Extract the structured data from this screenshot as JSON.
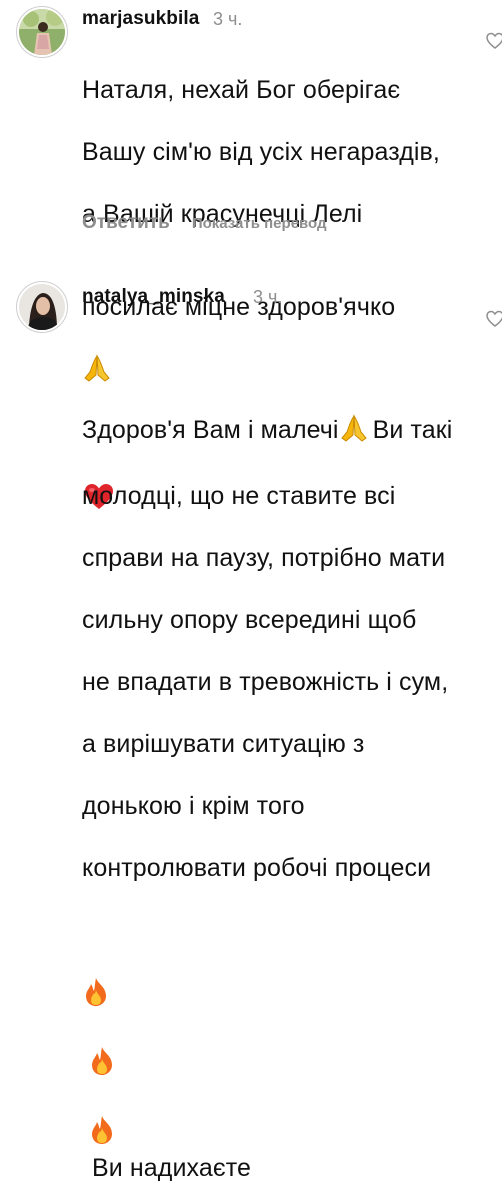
{
  "comments": [
    {
      "username": "marjasukbila",
      "time": "3 ч.",
      "text_lines": [
        "Наталя, нехай Бог оберігає",
        "Вашу сім'ю від усіх негараздів,",
        "а Вашій красунечці Лелі",
        "посилає міцне здоров'ячко"
      ],
      "reply_label": "Ответить",
      "translate_label": "Показать перевод",
      "emoji": [
        "praying-hands",
        "red-heart"
      ]
    },
    {
      "username": "natalya_minska",
      "time": "3 ч.",
      "text_lines": [
        "Здоров'я Вам і малечі",
        "Ви такі",
        "молодці, що не ставите всі",
        "справи на паузу, потрібно мати",
        "сильну опору всередині щоб",
        "не впадати в тревожність і сум,",
        "а вирішувати ситуацію з",
        "донькою і крім того",
        "контролювати робочі процеси",
        "Ви надихаєте"
      ],
      "emoji": [
        "praying-hands",
        "fire",
        "fire",
        "fire"
      ]
    }
  ],
  "colors": {
    "text": "#111111",
    "muted": "#8e8e8e",
    "heart": "#e0242c",
    "hands": "#f5b50a",
    "fire": "#f26a1b"
  }
}
